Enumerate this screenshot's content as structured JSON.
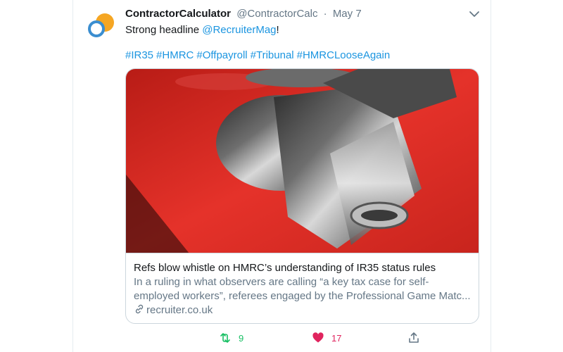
{
  "tweet": {
    "display_name": "ContractorCalculator",
    "handle": "@ContractorCalc",
    "separator": "·",
    "date": "May 7",
    "text_prefix": "Strong headline ",
    "mention": "@RecruiterMag",
    "text_suffix": "!",
    "hashtags": [
      "#IR35",
      "#HMRC",
      "#Offpayroll",
      "#Tribunal",
      "#HMRCLooseAgain"
    ]
  },
  "card": {
    "title": "Refs blow whistle on HMRC’s understanding of IR35 status rules",
    "description": "In a ruling in what observers are calling “a key tax case for self-employed workers”, referees engaged by the Professional Game Matc...",
    "domain": "recruiter.co.uk",
    "image_subject": "metal-whistle-on-red-background"
  },
  "actions": {
    "retweet_count": "9",
    "like_count": "17"
  },
  "colors": {
    "link_blue": "#1b95e0",
    "secondary_gray": "#657786",
    "retweet_green": "#17bf63",
    "like_red": "#e0245e",
    "avatar_orange": "#f5a623",
    "avatar_blue": "#3b8ed0"
  },
  "icons": [
    "avatar-logo-icon",
    "chevron-down-icon",
    "link-icon",
    "retweet-icon",
    "heart-icon",
    "share-icon"
  ]
}
